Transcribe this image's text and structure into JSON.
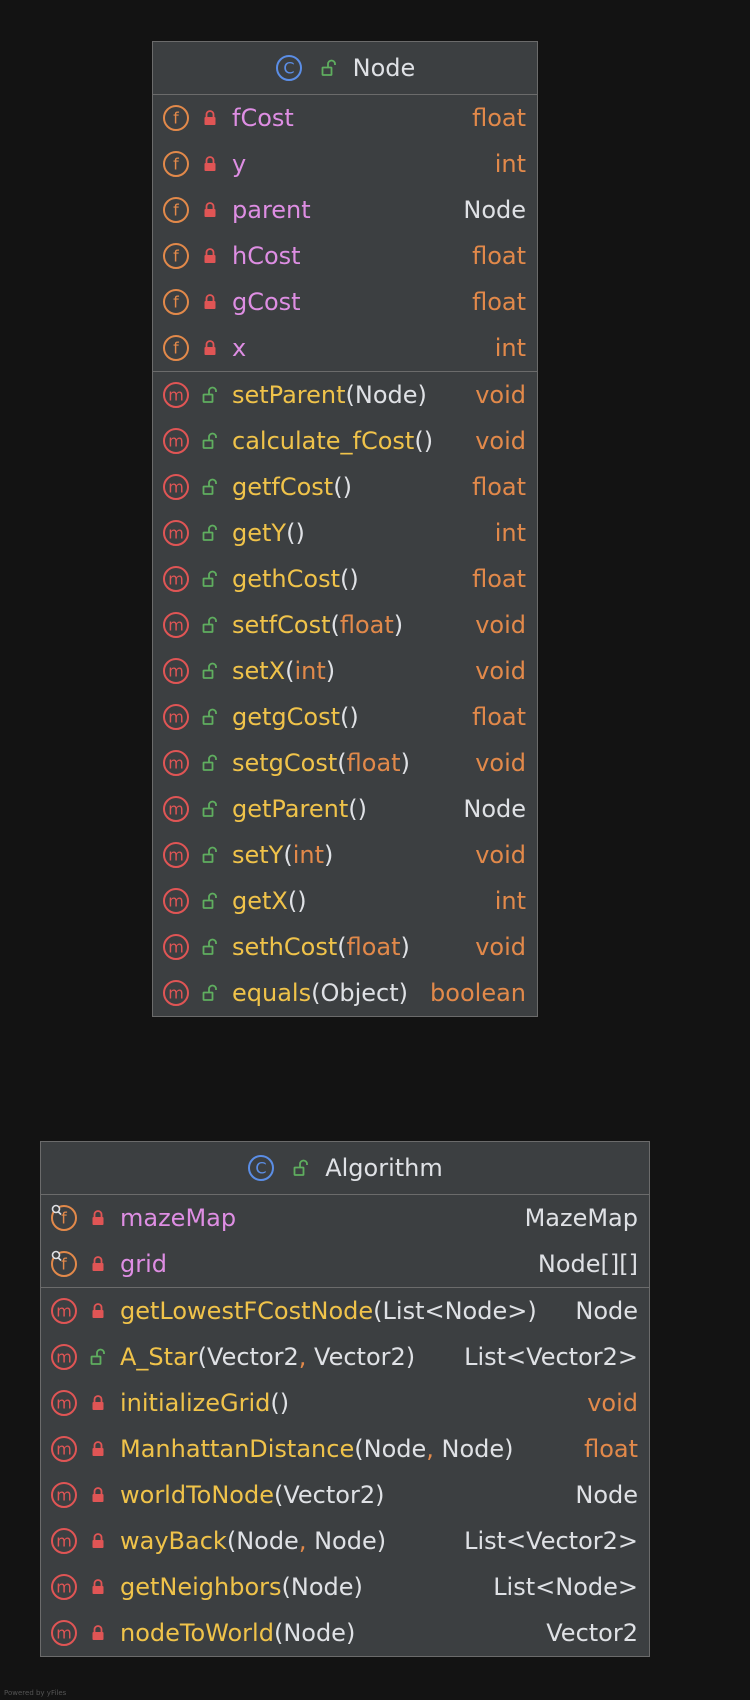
{
  "colors": {
    "background": "#131313",
    "box_fill": "#3c3f41",
    "box_border": "#6b6b6b",
    "field_name": "#de8ee3",
    "method_name": "#f0c34a",
    "primitive_type": "#e2894a",
    "plain_text": "#dfe1e5",
    "class_icon": "#5b8ee6",
    "field_icon": "#e2894a",
    "method_icon": "#e05555",
    "public_icon": "#5fae5f",
    "private_icon": "#e05555"
  },
  "classes": [
    {
      "id": "node",
      "name": "Node",
      "class_icon": "class-icon",
      "visibility": "public",
      "fields": [
        {
          "name": "fCost",
          "type": "float",
          "type_kind": "prim",
          "visibility": "private",
          "static": false
        },
        {
          "name": "y",
          "type": "int",
          "type_kind": "prim",
          "visibility": "private",
          "static": false
        },
        {
          "name": "parent",
          "type": "Node",
          "type_kind": "plain",
          "visibility": "private",
          "static": false
        },
        {
          "name": "hCost",
          "type": "float",
          "type_kind": "prim",
          "visibility": "private",
          "static": false
        },
        {
          "name": "gCost",
          "type": "float",
          "type_kind": "prim",
          "visibility": "private",
          "static": false
        },
        {
          "name": "x",
          "type": "int",
          "type_kind": "prim",
          "visibility": "private",
          "static": false
        }
      ],
      "methods": [
        {
          "name": "setParent",
          "params": [
            {
              "type": "Node",
              "kind": "plain"
            }
          ],
          "return": "void",
          "return_kind": "prim",
          "visibility": "public"
        },
        {
          "name": "calculate_fCost",
          "params": [],
          "return": "void",
          "return_kind": "prim",
          "visibility": "public"
        },
        {
          "name": "getfCost",
          "params": [],
          "return": "float",
          "return_kind": "prim",
          "visibility": "public"
        },
        {
          "name": "getY",
          "params": [],
          "return": "int",
          "return_kind": "prim",
          "visibility": "public"
        },
        {
          "name": "gethCost",
          "params": [],
          "return": "float",
          "return_kind": "prim",
          "visibility": "public"
        },
        {
          "name": "setfCost",
          "params": [
            {
              "type": "float",
              "kind": "prim"
            }
          ],
          "return": "void",
          "return_kind": "prim",
          "visibility": "public"
        },
        {
          "name": "setX",
          "params": [
            {
              "type": "int",
              "kind": "prim"
            }
          ],
          "return": "void",
          "return_kind": "prim",
          "visibility": "public"
        },
        {
          "name": "getgCost",
          "params": [],
          "return": "float",
          "return_kind": "prim",
          "visibility": "public"
        },
        {
          "name": "setgCost",
          "params": [
            {
              "type": "float",
              "kind": "prim"
            }
          ],
          "return": "void",
          "return_kind": "prim",
          "visibility": "public"
        },
        {
          "name": "getParent",
          "params": [],
          "return": "Node",
          "return_kind": "plain",
          "visibility": "public"
        },
        {
          "name": "setY",
          "params": [
            {
              "type": "int",
              "kind": "prim"
            }
          ],
          "return": "void",
          "return_kind": "prim",
          "visibility": "public"
        },
        {
          "name": "getX",
          "params": [],
          "return": "int",
          "return_kind": "prim",
          "visibility": "public"
        },
        {
          "name": "sethCost",
          "params": [
            {
              "type": "float",
              "kind": "prim"
            }
          ],
          "return": "void",
          "return_kind": "prim",
          "visibility": "public"
        },
        {
          "name": "equals",
          "params": [
            {
              "type": "Object",
              "kind": "plain"
            }
          ],
          "return": "boolean",
          "return_kind": "prim",
          "visibility": "public"
        }
      ]
    },
    {
      "id": "algorithm",
      "name": "Algorithm",
      "class_icon": "class-icon",
      "visibility": "public",
      "fields": [
        {
          "name": "mazeMap",
          "type": "MazeMap",
          "type_kind": "plain",
          "visibility": "private",
          "static": true
        },
        {
          "name": "grid",
          "type": "Node[][]",
          "type_kind": "plain",
          "visibility": "private",
          "static": true
        }
      ],
      "methods": [
        {
          "name": "getLowestFCostNode",
          "params": [
            {
              "type": "List<Node>",
              "kind": "plain"
            }
          ],
          "return": "Node",
          "return_kind": "plain",
          "visibility": "private"
        },
        {
          "name": "A_Star",
          "params": [
            {
              "type": "Vector2",
              "kind": "plain"
            },
            {
              "type": "Vector2",
              "kind": "plain"
            }
          ],
          "return": "List<Vector2>",
          "return_kind": "plain",
          "visibility": "public"
        },
        {
          "name": "initializeGrid",
          "params": [],
          "return": "void",
          "return_kind": "prim",
          "visibility": "private"
        },
        {
          "name": "ManhattanDistance",
          "params": [
            {
              "type": "Node",
              "kind": "plain"
            },
            {
              "type": "Node",
              "kind": "plain"
            }
          ],
          "return": "float",
          "return_kind": "prim",
          "visibility": "private"
        },
        {
          "name": "worldToNode",
          "params": [
            {
              "type": "Vector2",
              "kind": "plain"
            }
          ],
          "return": "Node",
          "return_kind": "plain",
          "visibility": "private"
        },
        {
          "name": "wayBack",
          "params": [
            {
              "type": "Node",
              "kind": "plain"
            },
            {
              "type": "Node",
              "kind": "plain"
            }
          ],
          "return": "List<Vector2>",
          "return_kind": "plain",
          "visibility": "private"
        },
        {
          "name": "getNeighbors",
          "params": [
            {
              "type": "Node",
              "kind": "plain"
            }
          ],
          "return": "List<Node>",
          "return_kind": "plain",
          "visibility": "private"
        },
        {
          "name": "nodeToWorld",
          "params": [
            {
              "type": "Node",
              "kind": "plain"
            }
          ],
          "return": "Vector2",
          "return_kind": "plain",
          "visibility": "private"
        }
      ]
    }
  ],
  "footer": "Powered by yFiles"
}
